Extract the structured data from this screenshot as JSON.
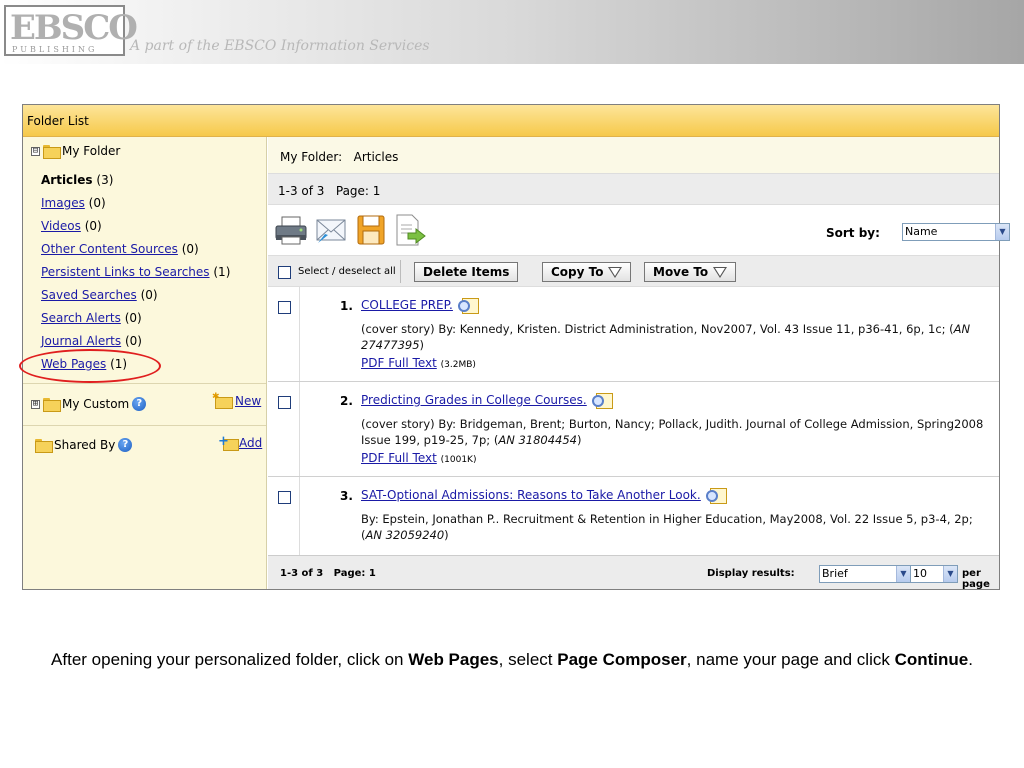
{
  "header": {
    "logo_main": "EBSCO",
    "logo_sub": "PUBLISHING",
    "tagline": "A part of the EBSCO Information Services"
  },
  "folder_list": {
    "title": "Folder List",
    "my_folder": "My Folder",
    "items": [
      {
        "label": "Articles",
        "count": "(3)"
      },
      {
        "label": "Images",
        "count": "(0)"
      },
      {
        "label": "Videos",
        "count": "(0)"
      },
      {
        "label": "Other Content Sources",
        "count": "(0)"
      },
      {
        "label": "Persistent Links to Searches",
        "count": "(1)"
      },
      {
        "label": "Saved Searches",
        "count": "(0)"
      },
      {
        "label": "Search Alerts",
        "count": "(0)"
      },
      {
        "label": "Journal Alerts",
        "count": "(0)"
      },
      {
        "label": "Web Pages",
        "count": "(1)"
      }
    ],
    "my_custom": "My Custom",
    "new_label": "New",
    "shared_by": "Shared By",
    "add_label": "Add",
    "expanded_glyph": "⊟",
    "collapsed_glyph": "⊞"
  },
  "main": {
    "title": "My Folder:   Articles",
    "count_text": "1-3 of 3   Page: 1",
    "sort_label": "Sort by:",
    "sort_value": "Name",
    "select_all": "Select / deselect all",
    "delete_label": "Delete Items",
    "copy_label": "Copy To",
    "move_label": "Move To",
    "results": [
      {
        "num": "1.",
        "title": "COLLEGE PREP.",
        "desc_a": "(cover story) By: Kennedy, Kristen. District Administration, Nov2007, Vol. 43 Issue 11, p36-41, 6p, 1c; (",
        "desc_an": "AN 27477395",
        "desc_b": ")",
        "pdf_label": "PDF Full Text",
        "pdf_size": "(3.2MB)"
      },
      {
        "num": "2.",
        "title": "Predicting Grades in College Courses.",
        "desc_a": "(cover story) By: Bridgeman, Brent; Burton, Nancy; Pollack, Judith. Journal of College Admission, Spring2008 Issue 199, p19-25, 7p; (",
        "desc_an": "AN 31804454",
        "desc_b": ")",
        "pdf_label": "PDF Full Text",
        "pdf_size": "(1001K)"
      },
      {
        "num": "3.",
        "title": "SAT-Optional Admissions: Reasons to Take Another Look.",
        "desc_a": "By: Epstein, Jonathan P.. Recruitment & Retention in Higher Education, May2008, Vol. 22 Issue 5, p3-4, 2p; (",
        "desc_an": "AN 32059240",
        "desc_b": ")"
      }
    ],
    "bottom_count": "1-3 of 3   Page: 1",
    "display_label": "Display results:",
    "display_value": "Brief",
    "per_value": "10",
    "per_page": "per page"
  },
  "caption": {
    "part1": "After opening your personalized folder, click on ",
    "bold1": "Web Pages",
    "part2": ", select ",
    "bold2": "Page Composer",
    "part3": ", name your page and click ",
    "bold3": "Continue",
    "part4": "."
  },
  "colors": {
    "link": "#1a1aa6",
    "header_gold": "#f6c94a",
    "left_panel": "#fcf8dc",
    "highlight_circle": "#e01f1f"
  }
}
